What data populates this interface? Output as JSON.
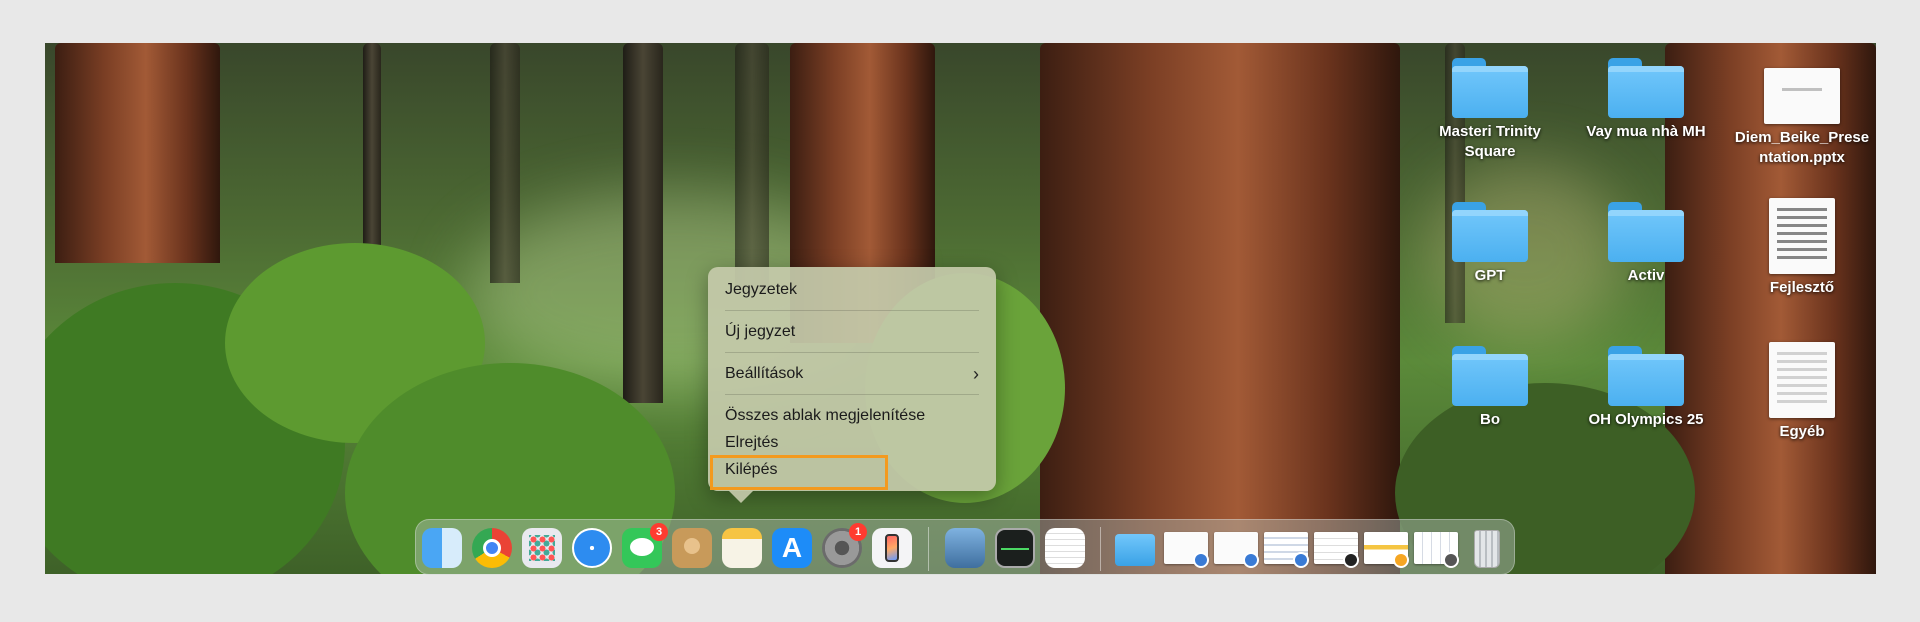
{
  "desktop": {
    "items": [
      {
        "label_line1": "Masteri Trinity",
        "label_line2": "Square",
        "type": "folder"
      },
      {
        "label_line1": "Vay mua nhà MH",
        "label_line2": "",
        "type": "folder"
      },
      {
        "label_line1": "Diem_Beike_Prese",
        "label_line2": "ntation.pptx",
        "type": "pptx-file"
      },
      {
        "label_line1": "GPT",
        "label_line2": "",
        "type": "folder"
      },
      {
        "label_line1": "Activ",
        "label_line2": "",
        "type": "folder"
      },
      {
        "label_line1": "Fejlesztő",
        "label_line2": "",
        "type": "document-file"
      },
      {
        "label_line1": "Bo",
        "label_line2": "",
        "type": "folder"
      },
      {
        "label_line1": "OH Olympics 25",
        "label_line2": "",
        "type": "folder"
      },
      {
        "label_line1": "Egyéb",
        "label_line2": "",
        "type": "document-file"
      }
    ]
  },
  "context_menu": {
    "title": "Jegyzetek",
    "items": [
      {
        "label": "Új jegyzet"
      },
      {
        "label": "Beállítások",
        "submenu_glyph": "›"
      },
      {
        "label": "Összes ablak megjelenítése"
      },
      {
        "label": "Elrejtés"
      },
      {
        "label": "Kilépés",
        "highlighted": true
      }
    ],
    "highlight_color": "#f39a1f"
  },
  "dock": {
    "apps": [
      {
        "icon": "finder-icon"
      },
      {
        "icon": "chrome-icon"
      },
      {
        "icon": "launchpad-icon"
      },
      {
        "icon": "safari-icon"
      },
      {
        "icon": "messages-icon",
        "badge": "3"
      },
      {
        "icon": "contacts-icon"
      },
      {
        "icon": "notes-icon"
      },
      {
        "icon": "app-store-icon"
      },
      {
        "icon": "system-settings-icon",
        "badge": "1"
      },
      {
        "icon": "iphone-mirroring-icon"
      },
      {
        "icon": "preview-icon"
      },
      {
        "icon": "activity-monitor-icon"
      },
      {
        "icon": "textedit-icon"
      },
      {
        "icon": "downloads-folder-icon"
      },
      {
        "icon": "trash-icon"
      }
    ]
  }
}
